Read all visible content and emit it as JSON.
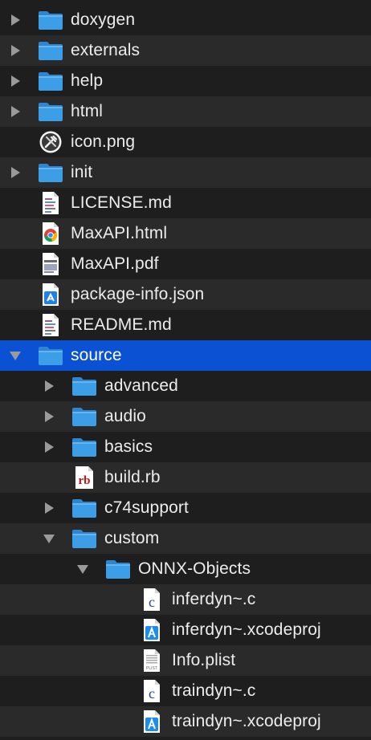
{
  "colors": {
    "row_bg_even": "#1e1e1e",
    "row_bg_odd": "#2a2a2a",
    "selection": "#0b51d3",
    "text": "#ececec",
    "folder_blue": "#3d9ee8",
    "disclosure_gray": "#9a9a9a"
  },
  "tree": {
    "items": [
      {
        "label": "doxygen",
        "kind": "folder",
        "icon": "folder-icon",
        "depth": 0,
        "disclosure": "collapsed",
        "selected": false
      },
      {
        "label": "externals",
        "kind": "folder",
        "icon": "folder-icon",
        "depth": 0,
        "disclosure": "collapsed",
        "selected": false
      },
      {
        "label": "help",
        "kind": "folder",
        "icon": "folder-icon",
        "depth": 0,
        "disclosure": "collapsed",
        "selected": false
      },
      {
        "label": "html",
        "kind": "folder",
        "icon": "folder-icon",
        "depth": 0,
        "disclosure": "collapsed",
        "selected": false
      },
      {
        "label": "icon.png",
        "kind": "file",
        "icon": "tools-image-icon",
        "depth": 0,
        "disclosure": "none",
        "selected": false
      },
      {
        "label": "init",
        "kind": "folder",
        "icon": "folder-icon",
        "depth": 0,
        "disclosure": "collapsed",
        "selected": false
      },
      {
        "label": "LICENSE.md",
        "kind": "file",
        "icon": "text-document-icon",
        "depth": 0,
        "disclosure": "none",
        "selected": false
      },
      {
        "label": "MaxAPI.html",
        "kind": "file",
        "icon": "chrome-document-icon",
        "depth": 0,
        "disclosure": "none",
        "selected": false
      },
      {
        "label": "MaxAPI.pdf",
        "kind": "file",
        "icon": "pdf-document-icon",
        "depth": 0,
        "disclosure": "none",
        "selected": false
      },
      {
        "label": "package-info.json",
        "kind": "file",
        "icon": "json-document-icon",
        "depth": 0,
        "disclosure": "none",
        "selected": false
      },
      {
        "label": "README.md",
        "kind": "file",
        "icon": "text-document-icon",
        "depth": 0,
        "disclosure": "none",
        "selected": false
      },
      {
        "label": "source",
        "kind": "folder",
        "icon": "folder-icon",
        "depth": 0,
        "disclosure": "expanded",
        "selected": true
      },
      {
        "label": "advanced",
        "kind": "folder",
        "icon": "folder-icon",
        "depth": 1,
        "disclosure": "collapsed",
        "selected": false
      },
      {
        "label": "audio",
        "kind": "folder",
        "icon": "folder-icon",
        "depth": 1,
        "disclosure": "collapsed",
        "selected": false
      },
      {
        "label": "basics",
        "kind": "folder",
        "icon": "folder-icon",
        "depth": 1,
        "disclosure": "collapsed",
        "selected": false
      },
      {
        "label": "build.rb",
        "kind": "file",
        "icon": "ruby-file-icon",
        "depth": 1,
        "disclosure": "none",
        "selected": false
      },
      {
        "label": "c74support",
        "kind": "folder",
        "icon": "folder-icon",
        "depth": 1,
        "disclosure": "collapsed",
        "selected": false
      },
      {
        "label": "custom",
        "kind": "folder",
        "icon": "folder-icon",
        "depth": 1,
        "disclosure": "expanded",
        "selected": false
      },
      {
        "label": "ONNX-Objects",
        "kind": "folder",
        "icon": "folder-icon",
        "depth": 2,
        "disclosure": "expanded",
        "selected": false
      },
      {
        "label": "inferdyn~.c",
        "kind": "file",
        "icon": "c-source-icon",
        "depth": 3,
        "disclosure": "none",
        "selected": false
      },
      {
        "label": "inferdyn~.xcodeproj",
        "kind": "file",
        "icon": "xcode-project-icon",
        "depth": 3,
        "disclosure": "none",
        "selected": false
      },
      {
        "label": "Info.plist",
        "kind": "file",
        "icon": "plist-document-icon",
        "depth": 3,
        "disclosure": "none",
        "selected": false
      },
      {
        "label": "traindyn~.c",
        "kind": "file",
        "icon": "c-source-icon",
        "depth": 3,
        "disclosure": "none",
        "selected": false
      },
      {
        "label": "traindyn~.xcodeproj",
        "kind": "file",
        "icon": "xcode-project-icon",
        "depth": 3,
        "disclosure": "none",
        "selected": false
      }
    ]
  }
}
